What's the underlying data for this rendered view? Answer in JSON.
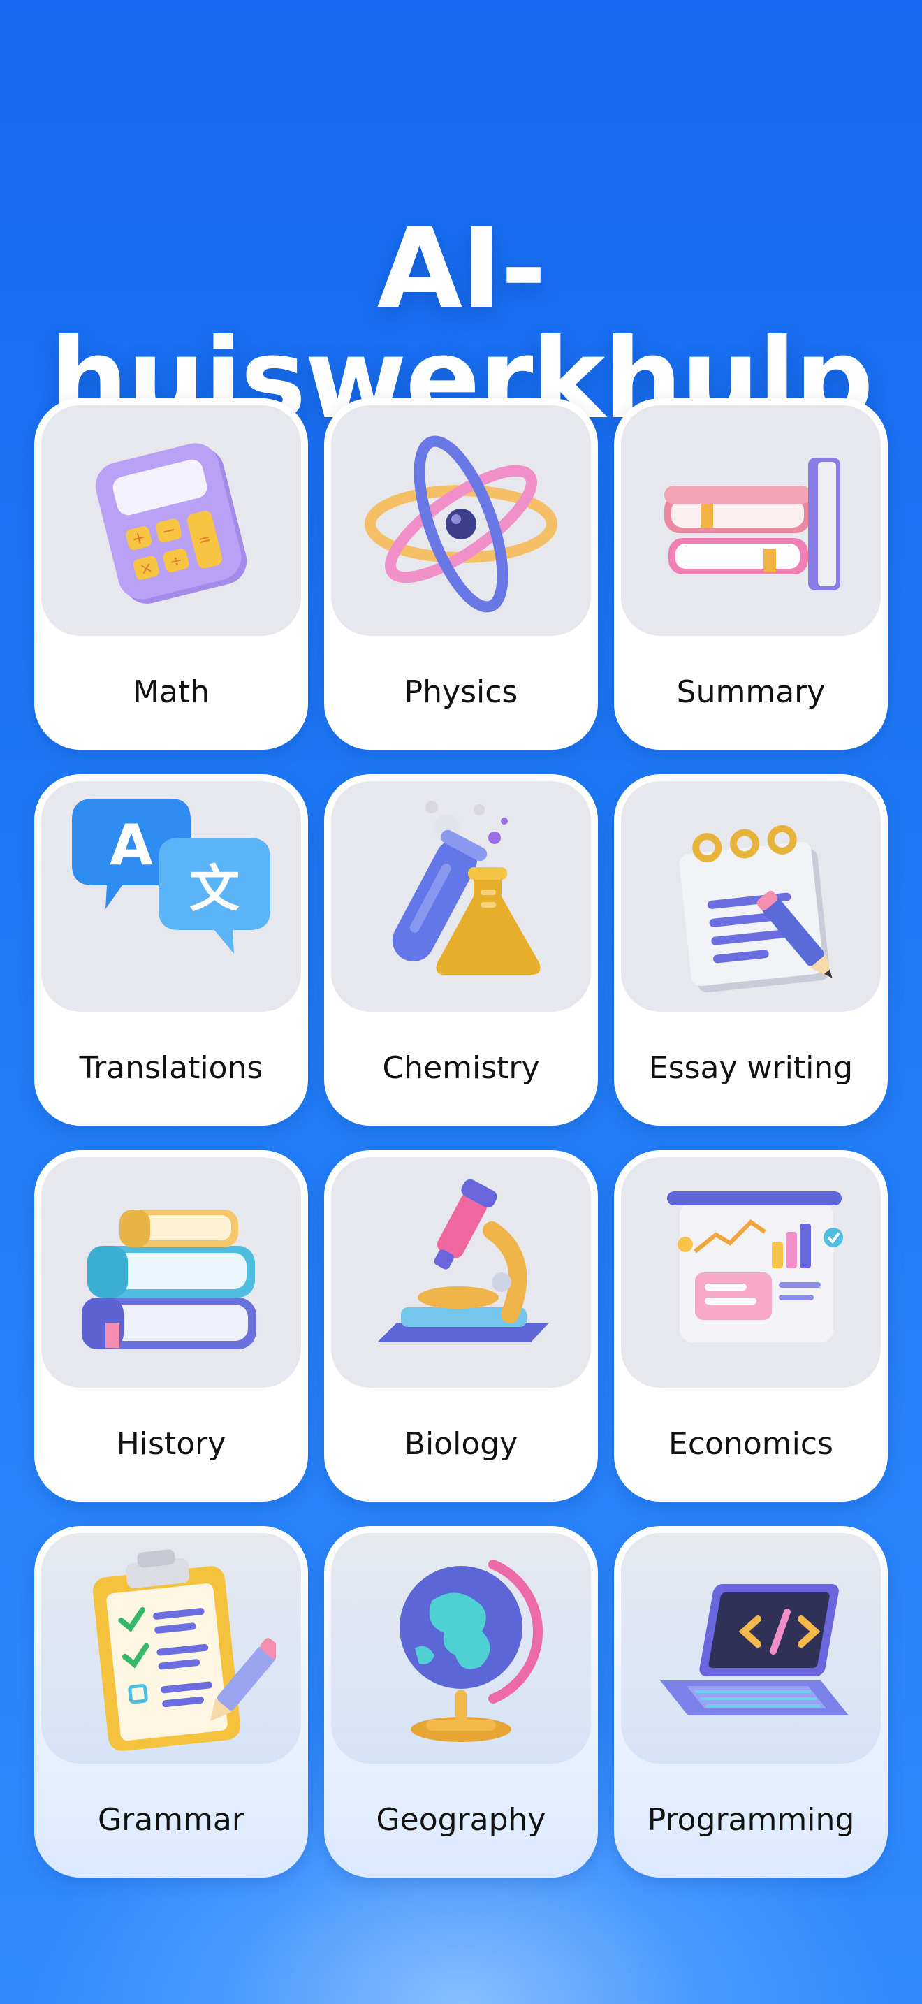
{
  "page": {
    "title": "AI-huiswerkhulp"
  },
  "subjects": [
    {
      "label": "Math",
      "icon": "calculator-icon"
    },
    {
      "label": "Physics",
      "icon": "atom-icon"
    },
    {
      "label": "Summary",
      "icon": "stacked-books-icon"
    },
    {
      "label": "Translations",
      "icon": "translate-bubbles-icon"
    },
    {
      "label": "Chemistry",
      "icon": "test-tube-flask-icon"
    },
    {
      "label": "Essay writing",
      "icon": "notepad-pencil-icon"
    },
    {
      "label": "History",
      "icon": "book-stack-icon"
    },
    {
      "label": "Biology",
      "icon": "microscope-icon"
    },
    {
      "label": "Economics",
      "icon": "presentation-board-icon"
    },
    {
      "label": "Grammar",
      "icon": "checklist-clipboard-icon"
    },
    {
      "label": "Geography",
      "icon": "globe-icon"
    },
    {
      "label": "Programming",
      "icon": "laptop-code-icon"
    }
  ],
  "colors": {
    "background_top": "#1669f0",
    "background_bottom": "#2f8bff",
    "card": "#ffffff",
    "tile": "#e7e8ed",
    "label_text": "#111111"
  }
}
